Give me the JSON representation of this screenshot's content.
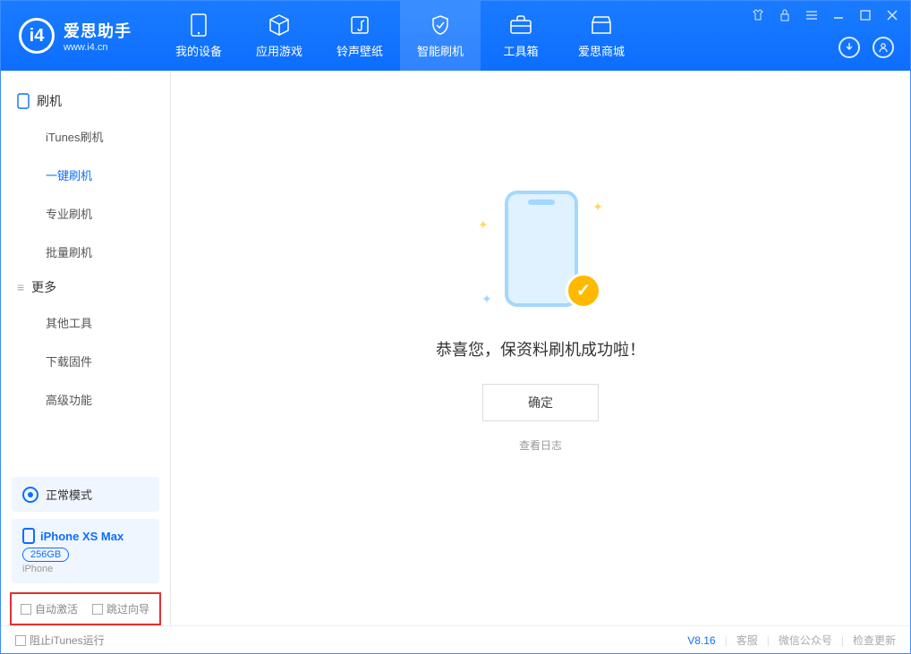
{
  "app": {
    "name": "爱思助手",
    "url": "www.i4.cn"
  },
  "nav": [
    {
      "label": "我的设备"
    },
    {
      "label": "应用游戏"
    },
    {
      "label": "铃声壁纸"
    },
    {
      "label": "智能刷机"
    },
    {
      "label": "工具箱"
    },
    {
      "label": "爱思商城"
    }
  ],
  "sidebar": {
    "section1_title": "刷机",
    "items1": [
      {
        "label": "iTunes刷机"
      },
      {
        "label": "一键刷机"
      },
      {
        "label": "专业刷机"
      },
      {
        "label": "批量刷机"
      }
    ],
    "section2_title": "更多",
    "items2": [
      {
        "label": "其他工具"
      },
      {
        "label": "下载固件"
      },
      {
        "label": "高级功能"
      }
    ]
  },
  "mode": {
    "label": "正常模式"
  },
  "device": {
    "name": "iPhone XS Max",
    "capacity": "256GB",
    "type": "iPhone"
  },
  "checkboxes": {
    "auto_activate": "自动激活",
    "skip_guide": "跳过向导"
  },
  "main": {
    "message": "恭喜您，保资料刷机成功啦！",
    "ok_label": "确定",
    "log_link": "查看日志"
  },
  "footer": {
    "block_itunes": "阻止iTunes运行",
    "version": "V8.16",
    "support": "客服",
    "wechat": "微信公众号",
    "check_update": "检查更新"
  }
}
